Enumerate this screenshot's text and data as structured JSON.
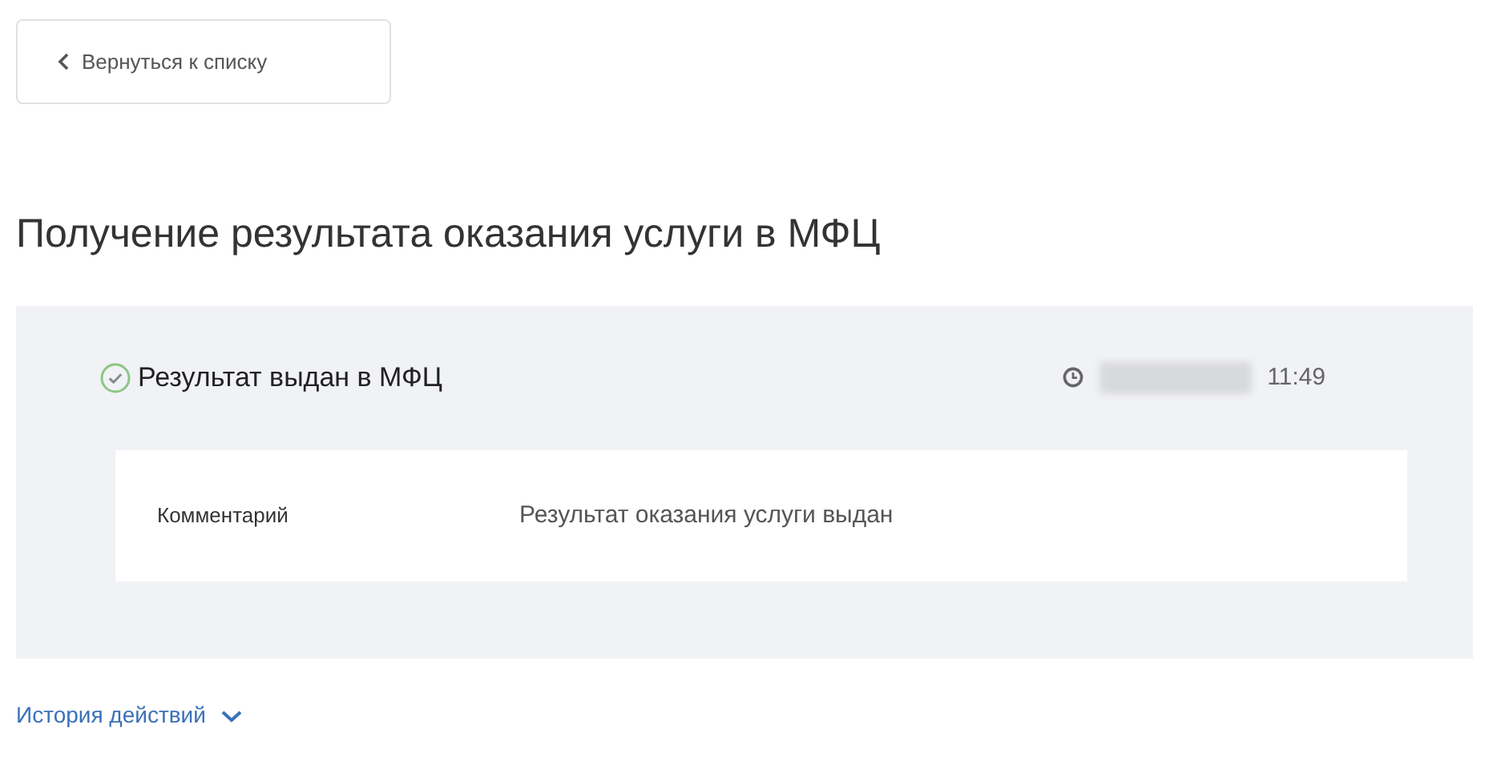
{
  "back_button": {
    "label": "Вернуться к списку"
  },
  "title": "Получение результата оказания услуги в МФЦ",
  "status": {
    "label": "Результат выдан в МФЦ",
    "done": true,
    "time": "11:49",
    "date_redacted": true
  },
  "details": [
    {
      "label": "Комментарий",
      "value": "Результат оказания услуги выдан"
    }
  ],
  "history": {
    "label": "История действий",
    "expanded": false
  }
}
